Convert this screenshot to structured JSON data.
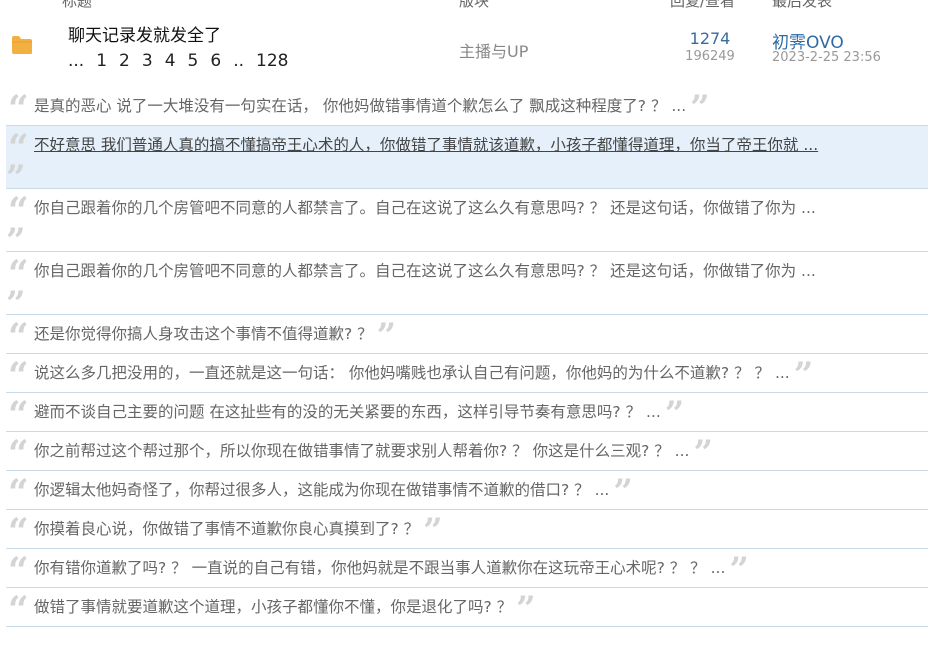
{
  "header": {
    "col_title": "标题",
    "col_forum": "版块",
    "col_stats": "回复/查看",
    "col_last": "最后发表"
  },
  "thread": {
    "icon": "folder-icon",
    "title": "聊天记录发就发全了",
    "pager": [
      "...",
      "1",
      "2",
      "3",
      "4",
      "5",
      "6",
      "..",
      "128"
    ],
    "forum": "主播与UP",
    "replies": "1274",
    "views": "196249",
    "last_user": "初霁OVO",
    "last_time": "2023-2-25 23:56"
  },
  "replies": [
    {
      "text": "是真的恶心 说了一大堆没有一句实在话， 你他妈做错事情道个歉怎么了 飘成这种程度了? ？ ..."
    },
    {
      "text": "不好意思 我们普通人真的搞不懂搞帝王心术的人，你做错了事情就该道歉，小孩子都懂得道理，你当了帝王你就 ...",
      "highlight": true,
      "wrap": true
    },
    {
      "text": "你自己跟着你的几个房管吧不同意的人都禁言了。自己在这说了这么久有意思吗? ？  还是这句话，你做错了你为 ...",
      "wrap": true
    },
    {
      "text": "你自己跟着你的几个房管吧不同意的人都禁言了。自己在这说了这么久有意思吗? ？  还是这句话，你做错了你为 ...",
      "wrap": true
    },
    {
      "text": "还是你觉得你搞人身攻击这个事情不值得道歉? ？"
    },
    {
      "text": "说这么多几把没用的，一直还就是这一句话： 你他妈嘴贱也承认自己有问题，你他妈的为什么不道歉? ？ ？ ..."
    },
    {
      "text": "避而不谈自己主要的问题 在这扯些有的没的无关紧要的东西，这样引导节奏有意思吗? ？ ..."
    },
    {
      "text": "你之前帮过这个帮过那个，所以你现在做错事情了就要求别人帮着你? ？  你这是什么三观? ？ ..."
    },
    {
      "text": "你逻辑太他妈奇怪了，你帮过很多人，这能成为你现在做错事情不道歉的借口? ？ ..."
    },
    {
      "text": "你摸着良心说，你做错了事情不道歉你良心真摸到了? ？"
    },
    {
      "text": "你有错你道歉了吗? ？  一直说的自己有错，你他妈就是不跟当事人道歉你在这玩帝王心术呢? ？ ？ ..."
    },
    {
      "text": "做错了事情就要道歉这个道理，小孩子都懂你不懂，你是退化了吗? ？"
    }
  ],
  "colors": {
    "accent": "#2f6aa6",
    "highlight_bg": "#e5f0fb",
    "divider": "#c9dbe8",
    "folder": "#f3b042"
  }
}
